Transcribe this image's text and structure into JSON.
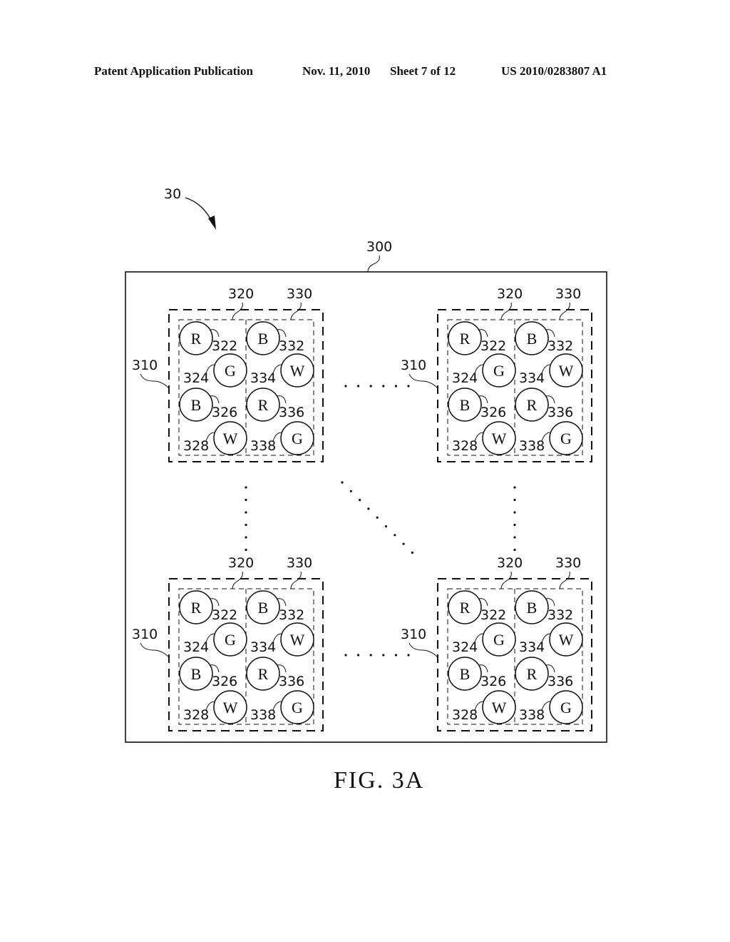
{
  "header": {
    "publication": "Patent Application Publication",
    "date": "Nov. 11, 2010",
    "sheet": "Sheet 7 of 12",
    "number": "US 2010/0283807 A1"
  },
  "figure": {
    "caption": "FIG. 3A",
    "device_ref": "30",
    "panel_ref": "300",
    "module": {
      "ref": "310",
      "left_group_ref": "320",
      "right_group_ref": "330",
      "left_group": [
        {
          "letter": "R",
          "ref": "322"
        },
        {
          "letter": "G",
          "ref": "324"
        },
        {
          "letter": "B",
          "ref": "326"
        },
        {
          "letter": "W",
          "ref": "328"
        }
      ],
      "right_group": [
        {
          "letter": "B",
          "ref": "332"
        },
        {
          "letter": "W",
          "ref": "334"
        },
        {
          "letter": "R",
          "ref": "336"
        },
        {
          "letter": "G",
          "ref": "338"
        }
      ]
    },
    "module_positions": [
      "top-left",
      "top-right",
      "bottom-left",
      "bottom-right"
    ],
    "ellipsis_links": [
      "horizontal-top",
      "horizontal-bottom",
      "vertical-left",
      "vertical-right",
      "diagonal"
    ]
  }
}
